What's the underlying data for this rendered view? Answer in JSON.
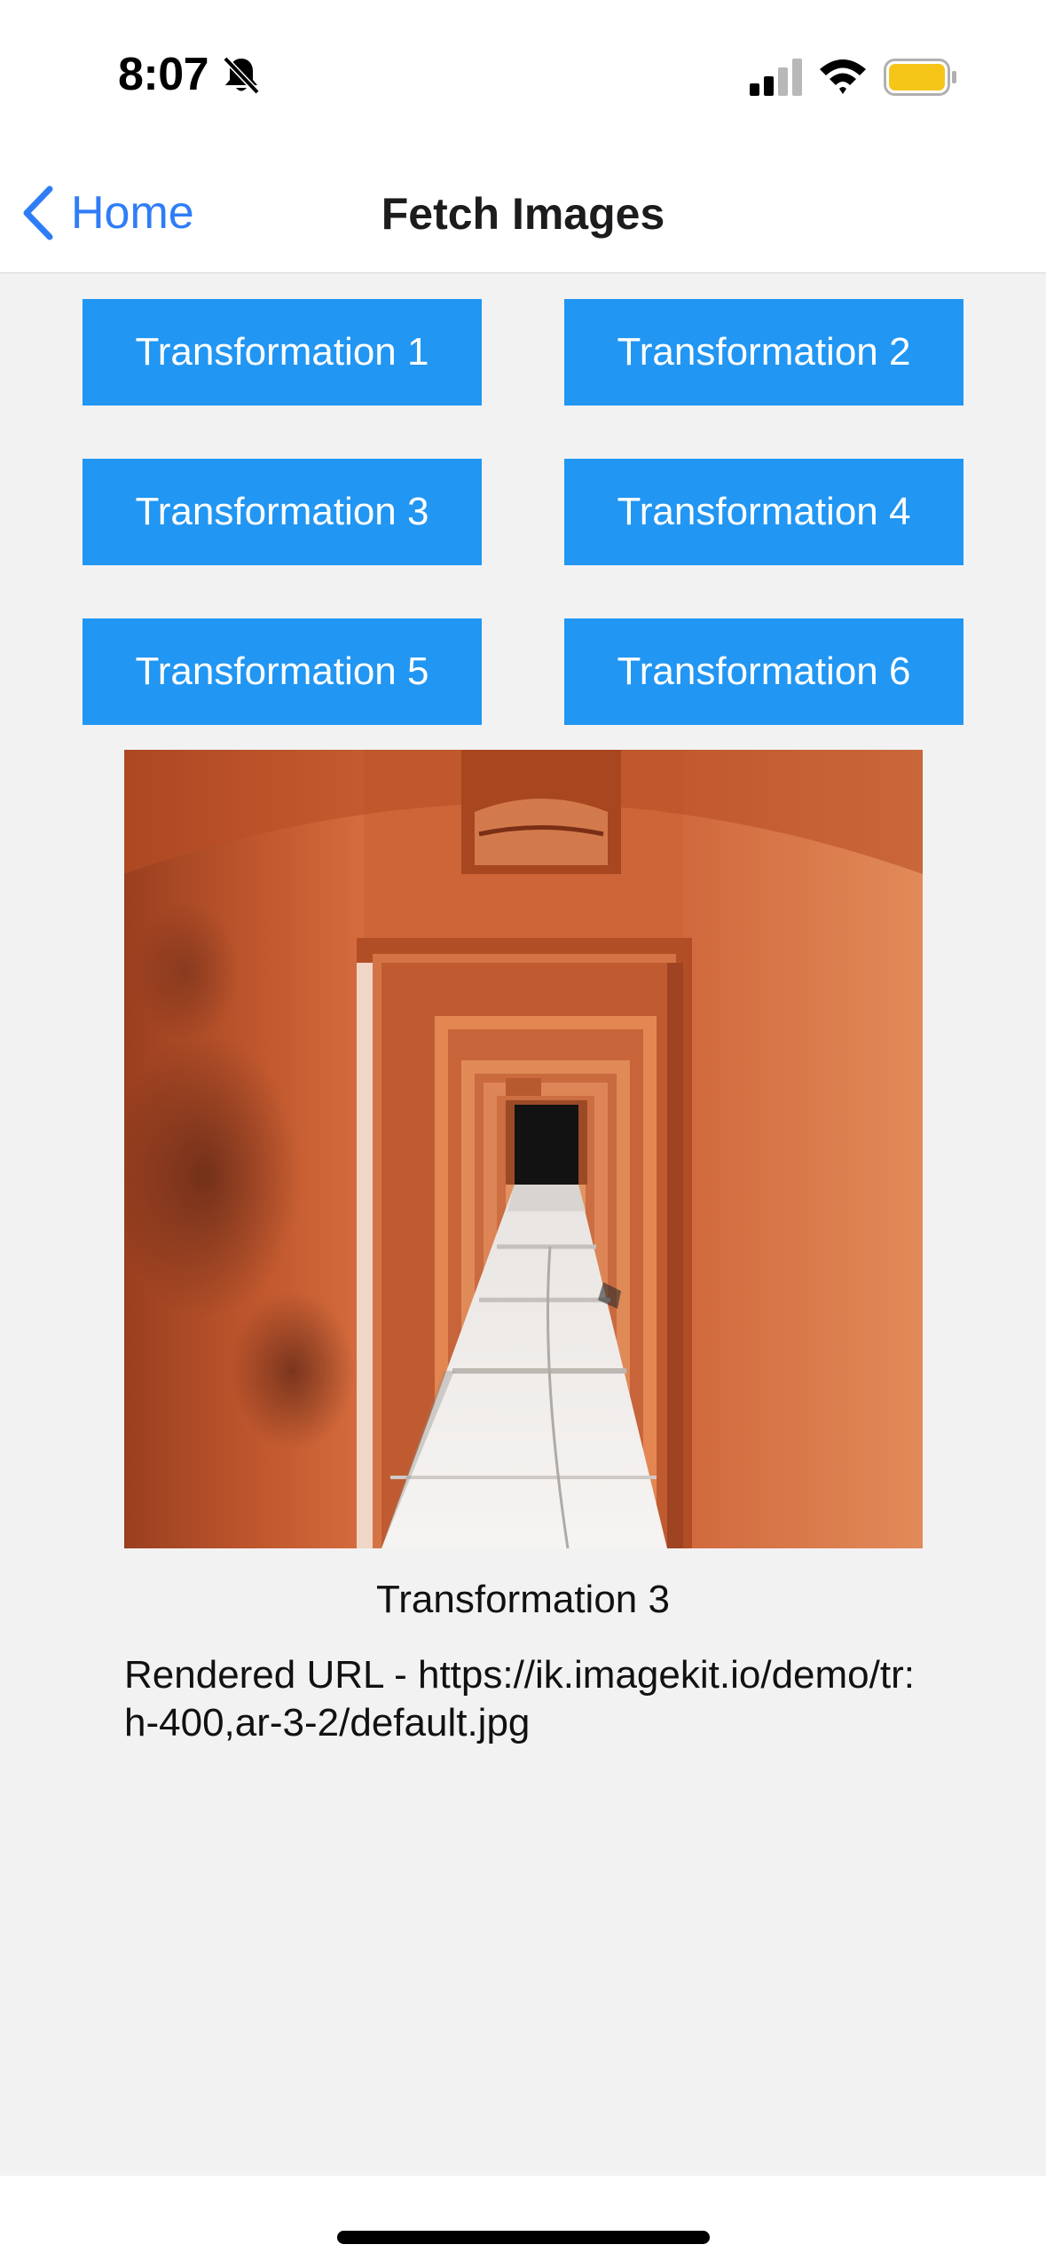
{
  "status_bar": {
    "time": "8:07",
    "icons": [
      "bell-slash-icon",
      "cellular-signal-icon",
      "wifi-icon",
      "battery-icon"
    ],
    "battery_color": "#f5c518"
  },
  "nav": {
    "back_label": "Home",
    "title": "Fetch Images",
    "accent_color": "#2f7df6"
  },
  "buttons": {
    "color": "#2196f3",
    "items": [
      {
        "label": "Transformation 1"
      },
      {
        "label": "Transformation 2"
      },
      {
        "label": "Transformation 3"
      },
      {
        "label": "Transformation 4"
      },
      {
        "label": "Transformation 5"
      },
      {
        "label": "Transformation 6"
      }
    ]
  },
  "image": {
    "caption": "Transformation 3",
    "rendered_url": "Rendered URL - https://ik.imagekit.io/demo/tr:h-400,ar-3-2/default.jpg"
  }
}
